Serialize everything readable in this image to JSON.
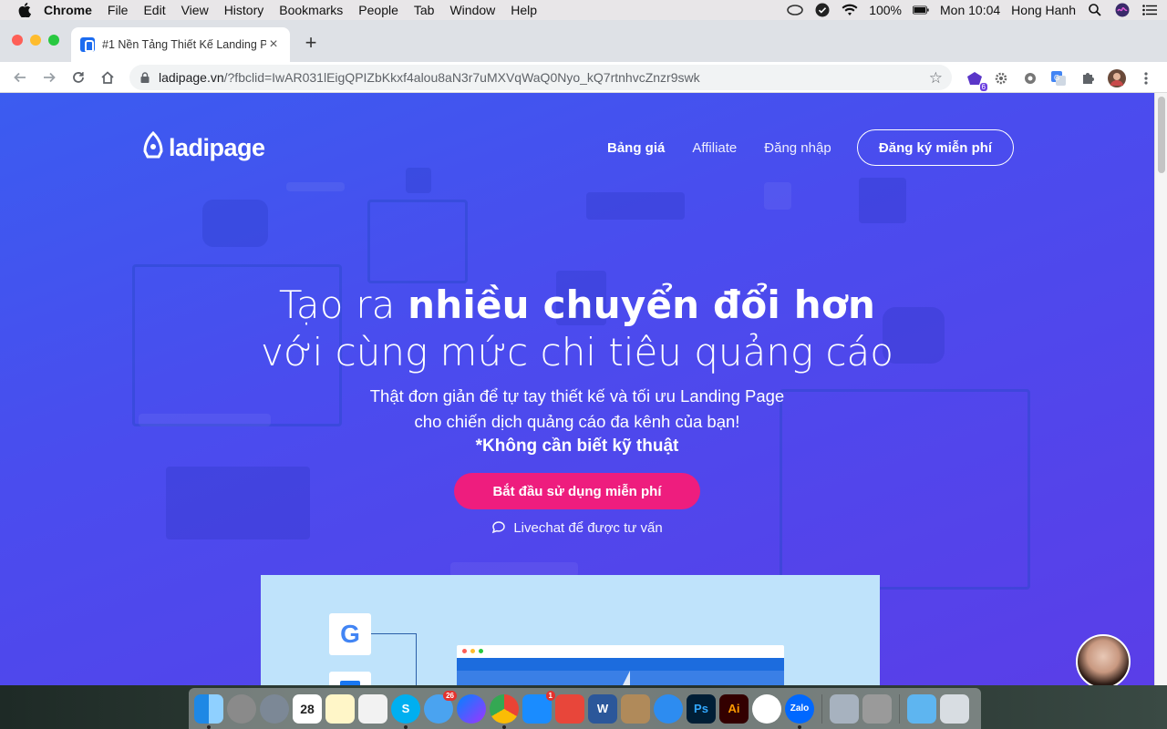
{
  "menubar": {
    "app": "Chrome",
    "items": [
      "File",
      "Edit",
      "View",
      "History",
      "Bookmarks",
      "People",
      "Tab",
      "Window",
      "Help"
    ],
    "battery": "100%",
    "clock": "Mon 10:04",
    "user": "Hong Hanh"
  },
  "browser": {
    "tab_title": "#1 Nền Tảng Thiết Kế Landing P",
    "url_host": "ladipage.vn",
    "url_rest": "/?fbclid=IwAR031lEigQPIZbKkxf4alou8aN3r7uMXVqWaQ0Nyo_kQ7rtnhvcZnzr9swk",
    "ext_badge": "6"
  },
  "site": {
    "logo_text": "ladipage",
    "nav": [
      "Bảng giá",
      "Affiliate",
      "Đăng nhập"
    ],
    "signup": "Đăng ký miễn phí",
    "headline_pre": "Tạo ra ",
    "headline_bold": "nhiều chuyển đổi hơn",
    "headline_line2": "với cùng mức chi tiêu quảng cáo",
    "sub_line1": "Thật đơn giản để tự tay thiết kế và tối ưu Landing Page",
    "sub_line2": "cho chiến dịch quảng cáo đa kênh của bạn!",
    "sub_line3": "*Không cần biết kỹ thuật",
    "cta": "Bắt đầu sử dụng miễn phí",
    "livechat": "Livechat để được tư vấn",
    "google_letter": "G"
  },
  "dock": {
    "calendar_date": "28",
    "messenger_badge": "26",
    "appstore_badge": "1",
    "labels": {
      "skype": "S",
      "word": "W",
      "photoshop": "Ps",
      "illustrator": "Ai",
      "zalo": "Zalo"
    }
  },
  "colors": {
    "hero_start": "#3b5cf0",
    "hero_end": "#5a3ee8",
    "cta": "#ee1d7e",
    "preview_bg": "#bfe3fb"
  }
}
